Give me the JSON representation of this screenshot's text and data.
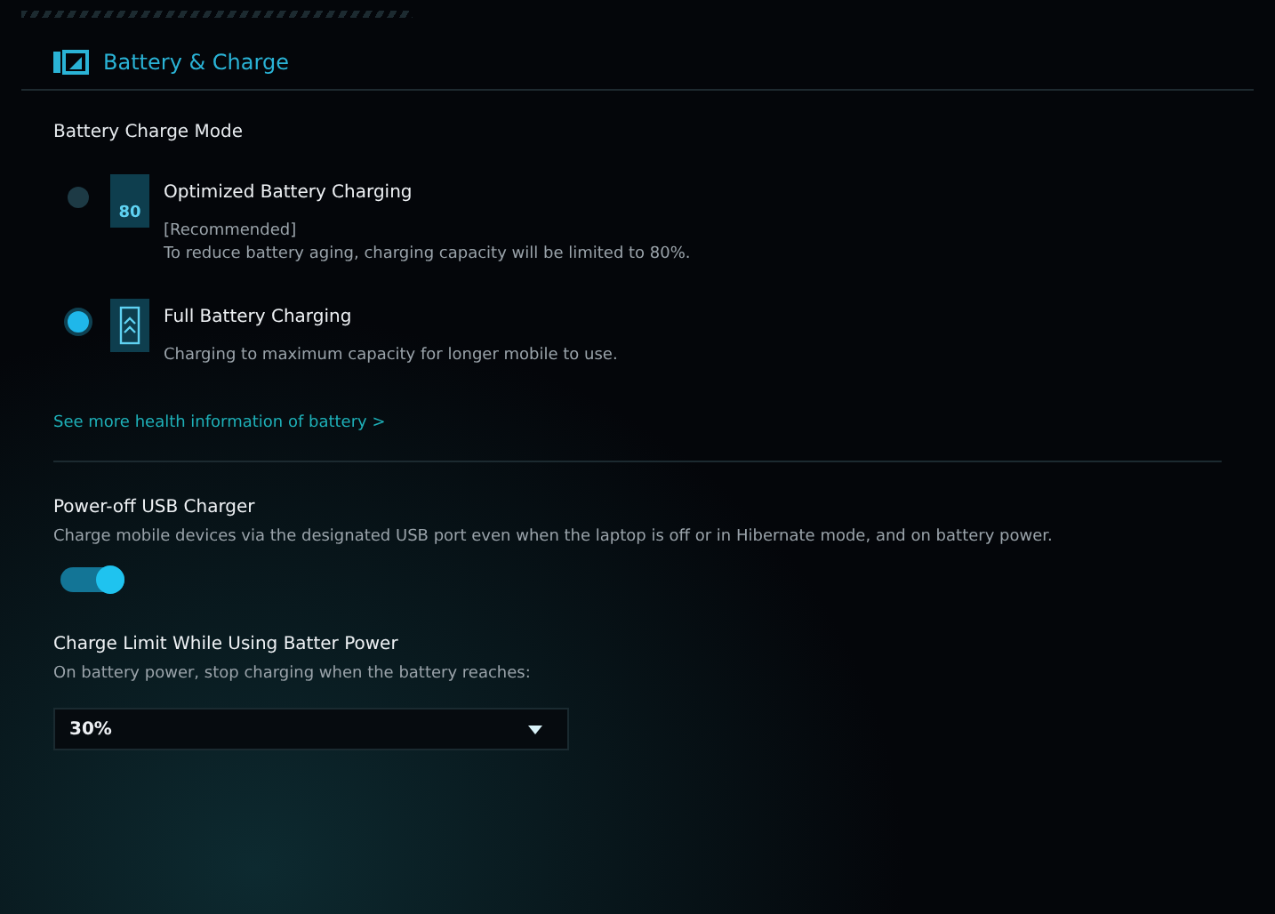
{
  "header": {
    "title": "Battery & Charge"
  },
  "charge_mode": {
    "title": "Battery Charge Mode",
    "options": [
      {
        "kind": "optimized",
        "selected": false,
        "icon_text": "80",
        "label": "Optimized Battery Charging",
        "notes": [
          "[Recommended]",
          "To reduce battery aging, charging capacity will be limited to 80%."
        ]
      },
      {
        "kind": "full",
        "selected": true,
        "label": "Full Battery Charging",
        "notes": [
          "Charging to maximum capacity for longer mobile to use."
        ]
      }
    ],
    "link": {
      "label": "See more health information of battery",
      "arrow": ">"
    }
  },
  "usb_charger": {
    "title": "Power-off USB Charger",
    "description": "Charge mobile devices via the designated USB port even when the laptop is off or in Hibernate mode, and on battery power.",
    "on": true
  },
  "charge_limit": {
    "title": "Charge Limit While Using Batter Power",
    "description": "On battery power, stop charging when the battery reaches:",
    "value": "30%"
  }
}
